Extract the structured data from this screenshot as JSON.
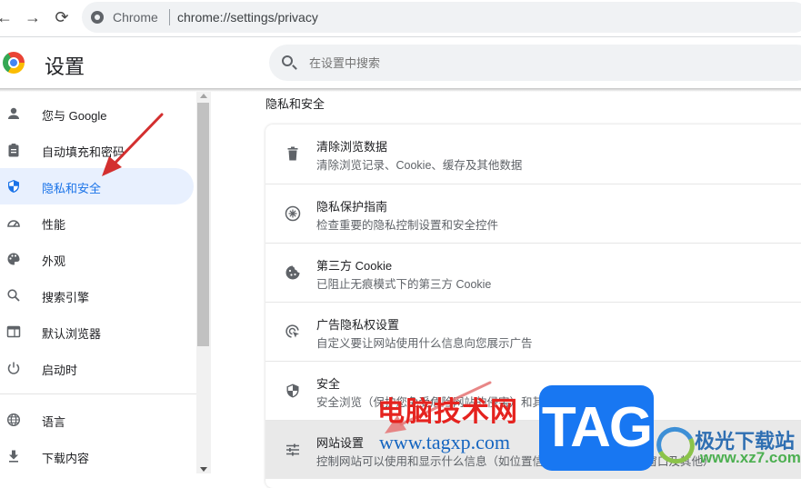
{
  "browser": {
    "nav": {
      "back": "←",
      "forward": "→",
      "reload": "⟳"
    },
    "omnibox": {
      "site_label": "Chrome",
      "url": "chrome://settings/privacy"
    }
  },
  "header": {
    "title": "设置",
    "search_placeholder": "在设置中搜索"
  },
  "sidebar": {
    "items": [
      {
        "label": "您与 Google",
        "icon": "person-icon",
        "active": false
      },
      {
        "label": "自动填充和密码",
        "icon": "clipboard-icon",
        "active": false
      },
      {
        "label": "隐私和安全",
        "icon": "shield-icon",
        "active": true
      },
      {
        "label": "性能",
        "icon": "speedometer-icon",
        "active": false
      },
      {
        "label": "外观",
        "icon": "palette-icon",
        "active": false
      },
      {
        "label": "搜索引擎",
        "icon": "search-icon",
        "active": false
      },
      {
        "label": "默认浏览器",
        "icon": "browser-window-icon",
        "active": false
      },
      {
        "label": "启动时",
        "icon": "power-icon",
        "active": false
      },
      {
        "label": "语言",
        "icon": "globe-icon",
        "active": false
      },
      {
        "label": "下载内容",
        "icon": "download-icon",
        "active": false
      }
    ]
  },
  "main": {
    "section_title": "隐私和安全",
    "rows": [
      {
        "title": "清除浏览数据",
        "subtitle": "清除浏览记录、Cookie、缓存及其他数据",
        "icon": "trash-icon"
      },
      {
        "title": "隐私保护指南",
        "subtitle": "检查重要的隐私控制设置和安全控件",
        "icon": "privacy-guide-icon"
      },
      {
        "title": "第三方 Cookie",
        "subtitle": "已阻止无痕模式下的第三方 Cookie",
        "icon": "cookie-icon"
      },
      {
        "title": "广告隐私权设置",
        "subtitle": "自定义要让网站使用什么信息向您展示广告",
        "icon": "ad-privacy-icon"
      },
      {
        "title": "安全",
        "subtitle": "安全浏览（保护您免受危险网站的侵害）和其他安全设置",
        "icon": "security-shield-icon"
      },
      {
        "title": "网站设置",
        "subtitle": "控制网站可以使用和显示什么信息（如位置信息、摄像头、弹出式窗口及其他）",
        "icon": "tune-icon"
      }
    ]
  },
  "watermarks": {
    "site_name": "电脑技术网",
    "site_url": "www.tagxp.com",
    "tag_logo": "TAG",
    "xz_name": "极光下载站",
    "xz_url": "www.xz7.com"
  },
  "colors": {
    "accent": "#1a73e8",
    "active_bg": "#e8f0fe",
    "arrow": "#d32f2f"
  }
}
